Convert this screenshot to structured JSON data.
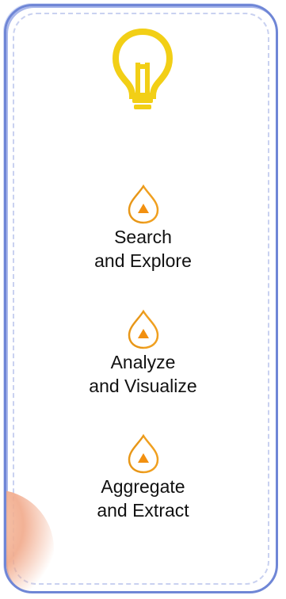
{
  "icons": {
    "main": "lightbulb-icon",
    "step": "droplet-arrow-up-icon"
  },
  "colors": {
    "panel_border": "#6f86d6",
    "panel_dash": "#c9d1f0",
    "bulb": "#f7dc2a",
    "bulb_outline": "#e0b800",
    "drop_outline": "#f0a020",
    "arrow": "#f29010"
  },
  "steps": [
    {
      "line1": "Search",
      "line2": "and Explore"
    },
    {
      "line1": "Analyze",
      "line2": "and Visualize"
    },
    {
      "line1": "Aggregate",
      "line2": "and Extract"
    }
  ]
}
